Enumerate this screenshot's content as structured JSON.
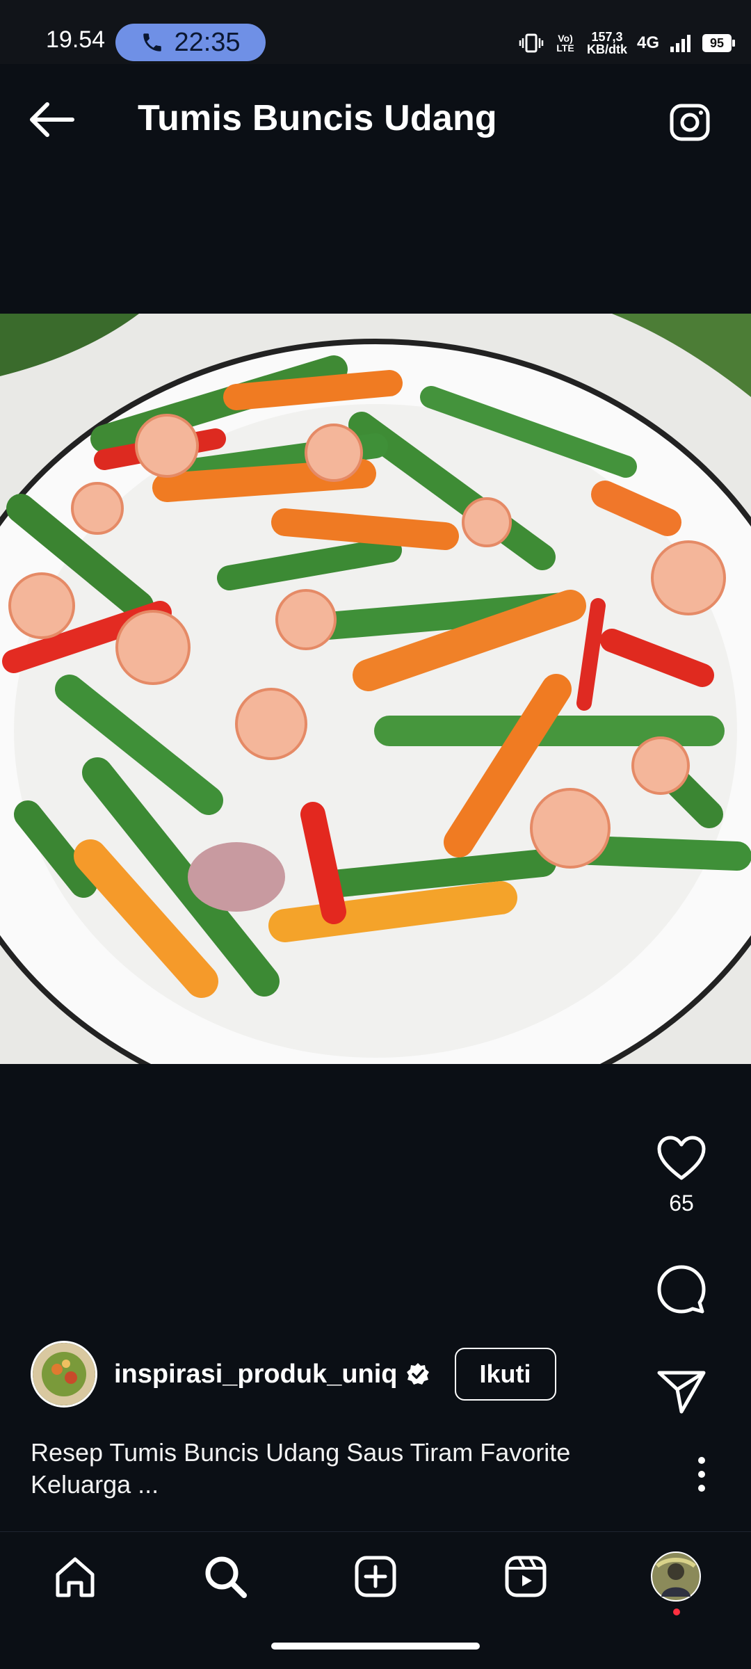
{
  "status_bar": {
    "time": "19.54",
    "call_duration": "22:35",
    "volte_label": "Vo) LTE",
    "net_speed_value": "157,3",
    "net_speed_unit": "KB/dtk",
    "network": "4G",
    "battery": "95"
  },
  "header": {
    "title": "Tumis Buncis Udang"
  },
  "actions": {
    "like_count": "65"
  },
  "author": {
    "username": "inspirasi_produk_uniq",
    "follow_label": "Ikuti"
  },
  "caption": {
    "line1": "Resep Tumis Buncis Udang Saus Tiram Favorite",
    "line2": "Keluarga ..."
  },
  "nav": {
    "items": [
      "home-icon",
      "search-icon",
      "create-icon",
      "reels-icon",
      "profile-avatar"
    ]
  },
  "colors": {
    "background": "#0b0f15",
    "call_pill": "#6f90e6",
    "notification_dot": "#ff3040"
  }
}
